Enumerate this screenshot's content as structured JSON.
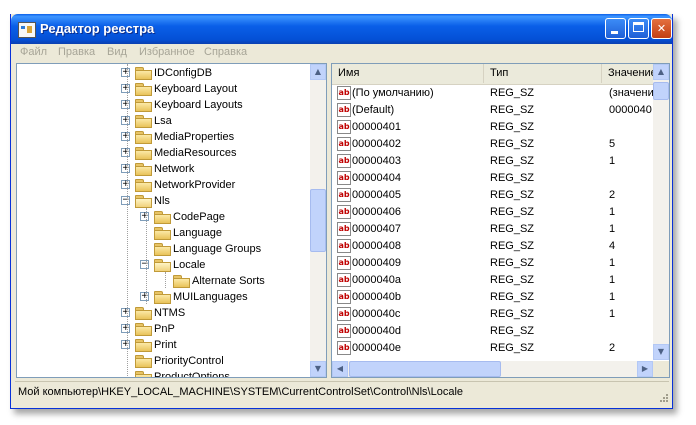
{
  "window": {
    "title": "Редактор реестра"
  },
  "menu": [
    "Файл",
    "Правка",
    "Вид",
    "Избранное",
    "Справка"
  ],
  "tree": {
    "items": [
      {
        "label": "IDConfigDB",
        "indent": 0,
        "expander": "+",
        "open": false
      },
      {
        "label": "Keyboard Layout",
        "indent": 0,
        "expander": "+",
        "open": false
      },
      {
        "label": "Keyboard Layouts",
        "indent": 0,
        "expander": "+",
        "open": false
      },
      {
        "label": "Lsa",
        "indent": 0,
        "expander": "+",
        "open": false
      },
      {
        "label": "MediaProperties",
        "indent": 0,
        "expander": "+",
        "open": false
      },
      {
        "label": "MediaResources",
        "indent": 0,
        "expander": "+",
        "open": false
      },
      {
        "label": "Network",
        "indent": 0,
        "expander": "+",
        "open": false
      },
      {
        "label": "NetworkProvider",
        "indent": 0,
        "expander": "+",
        "open": false
      },
      {
        "label": "Nls",
        "indent": 0,
        "expander": "-",
        "open": true
      },
      {
        "label": "CodePage",
        "indent": 1,
        "expander": "+",
        "open": false
      },
      {
        "label": "Language",
        "indent": 1,
        "expander": "",
        "open": false
      },
      {
        "label": "Language Groups",
        "indent": 1,
        "expander": "",
        "open": false
      },
      {
        "label": "Locale",
        "indent": 1,
        "expander": "-",
        "open": true
      },
      {
        "label": "Alternate Sorts",
        "indent": 2,
        "expander": "",
        "open": false
      },
      {
        "label": "MUILanguages",
        "indent": 1,
        "expander": "+",
        "open": false
      },
      {
        "label": "NTMS",
        "indent": 0,
        "expander": "+",
        "open": false
      },
      {
        "label": "PnP",
        "indent": 0,
        "expander": "+",
        "open": false
      },
      {
        "label": "Print",
        "indent": 0,
        "expander": "+",
        "open": false
      },
      {
        "label": "PriorityControl",
        "indent": 0,
        "expander": "",
        "open": false
      },
      {
        "label": "ProductOptions",
        "indent": 0,
        "expander": "",
        "open": false
      }
    ]
  },
  "list": {
    "columns": [
      "Имя",
      "Тип",
      "Значение"
    ],
    "rows": [
      {
        "name": "(По умолчанию)",
        "type": "REG_SZ",
        "value": "(значение"
      },
      {
        "name": "(Default)",
        "type": "REG_SZ",
        "value": "0000040"
      },
      {
        "name": "00000401",
        "type": "REG_SZ",
        "value": ""
      },
      {
        "name": "00000402",
        "type": "REG_SZ",
        "value": "5"
      },
      {
        "name": "00000403",
        "type": "REG_SZ",
        "value": "1"
      },
      {
        "name": "00000404",
        "type": "REG_SZ",
        "value": ""
      },
      {
        "name": "00000405",
        "type": "REG_SZ",
        "value": "2"
      },
      {
        "name": "00000406",
        "type": "REG_SZ",
        "value": "1"
      },
      {
        "name": "00000407",
        "type": "REG_SZ",
        "value": "1"
      },
      {
        "name": "00000408",
        "type": "REG_SZ",
        "value": "4"
      },
      {
        "name": "00000409",
        "type": "REG_SZ",
        "value": "1"
      },
      {
        "name": "0000040a",
        "type": "REG_SZ",
        "value": "1"
      },
      {
        "name": "0000040b",
        "type": "REG_SZ",
        "value": "1"
      },
      {
        "name": "0000040c",
        "type": "REG_SZ",
        "value": "1"
      },
      {
        "name": "0000040d",
        "type": "REG_SZ",
        "value": ""
      },
      {
        "name": "0000040e",
        "type": "REG_SZ",
        "value": "2"
      }
    ]
  },
  "status": {
    "path": "Мой компьютер\\HKEY_LOCAL_MACHINE\\SYSTEM\\CurrentControlSet\\Control\\Nls\\Locale"
  },
  "icons": {
    "minimize": "minimize-icon",
    "maximize": "maximize-icon",
    "close": "close-icon",
    "folder": "folder-icon",
    "string_value": "string-value-icon"
  },
  "colors": {
    "titlebar": "#0a5fe8",
    "menu_disabled": "#a7a597",
    "value_icon": "#c00000"
  }
}
